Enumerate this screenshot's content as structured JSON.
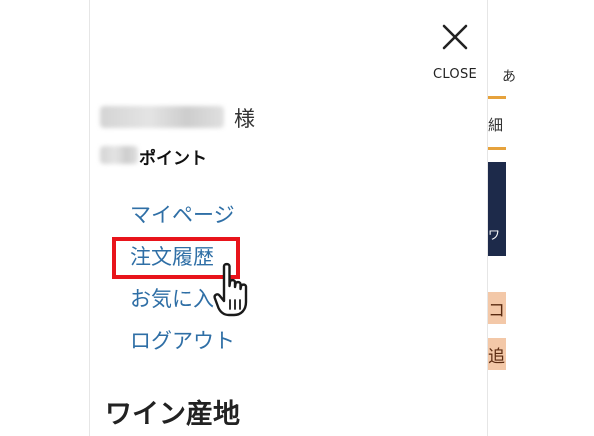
{
  "drawer": {
    "close_label": "CLOSE",
    "user": {
      "honorific": "様"
    },
    "points_label": "ポイント",
    "nav_items": [
      {
        "label": "マイページ"
      },
      {
        "label": "注文履歴"
      },
      {
        "label": "お気に入"
      },
      {
        "label": "ログアウト"
      }
    ],
    "section_heading": "ワイン産地"
  },
  "background_page": {
    "tab_fragment": "あ",
    "band_char": "細",
    "navy_text": "ワ",
    "peach_text_1": "コ",
    "peach_text_2": "追"
  },
  "colors": {
    "link": "#2f6fa6",
    "highlight": "#e8141b",
    "navy": "#1d2a4a",
    "accent_orange": "#e6a23c"
  }
}
